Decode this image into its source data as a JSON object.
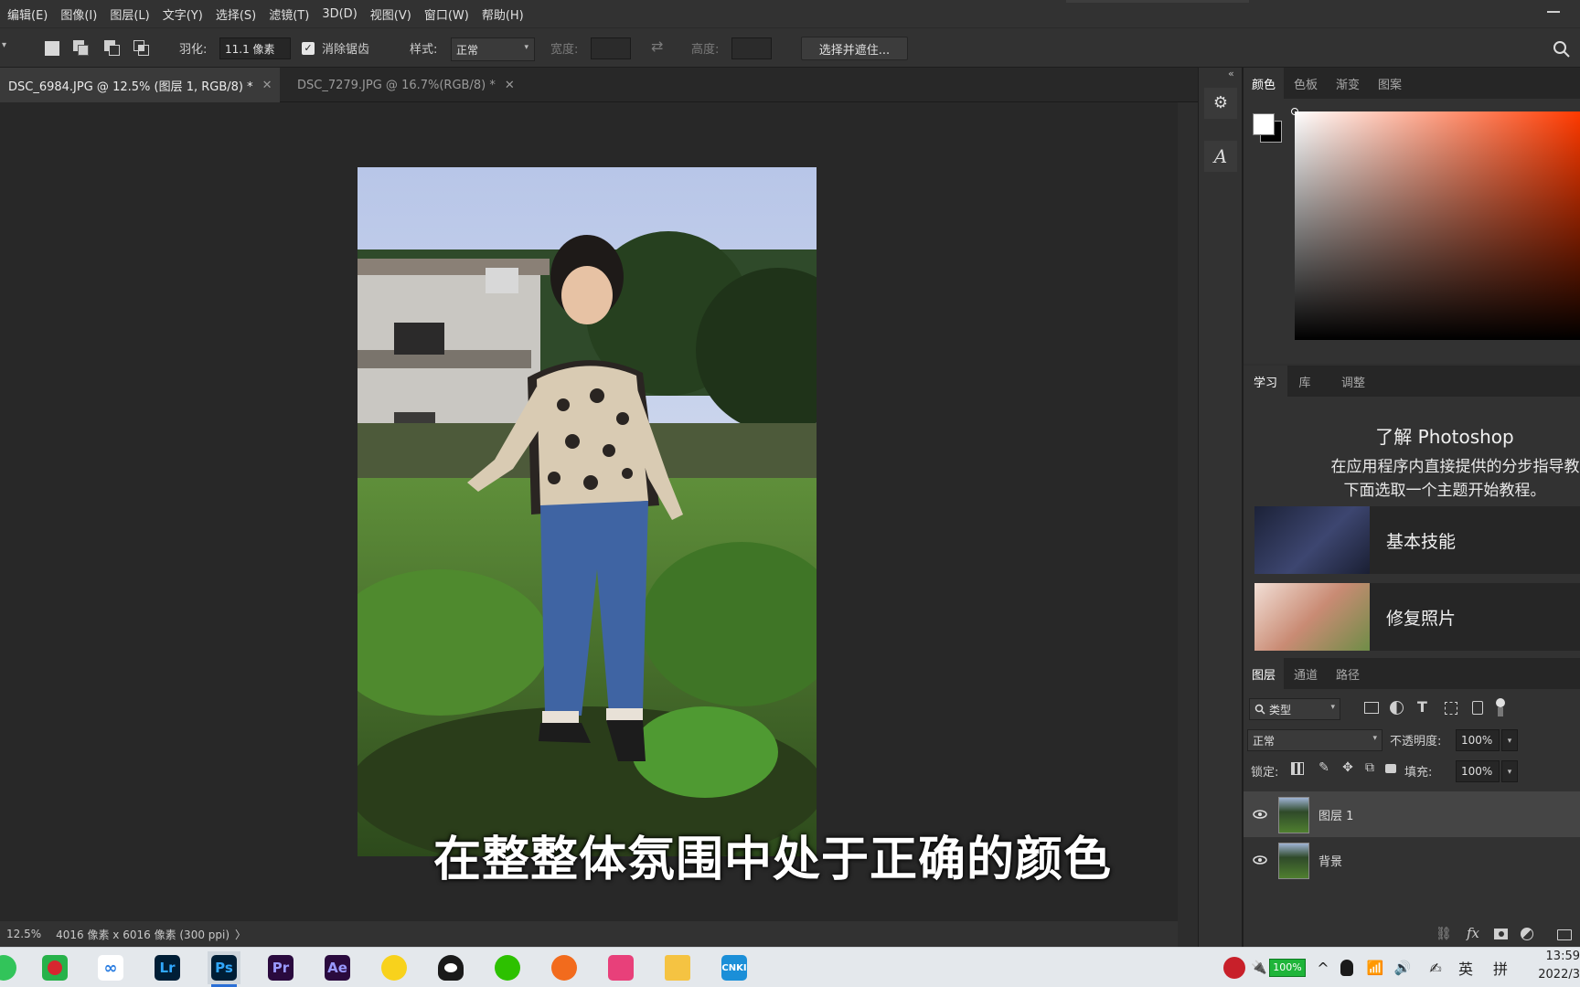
{
  "menu": {
    "items": [
      "编辑(E)",
      "图像(I)",
      "图层(L)",
      "文字(Y)",
      "选择(S)",
      "滤镜(T)",
      "3D(D)",
      "视图(V)",
      "窗口(W)",
      "帮助(H)"
    ]
  },
  "options": {
    "feather_label": "羽化:",
    "feather_value": "11.1 像素",
    "antialias_label": "消除锯齿",
    "antialias_checked": true,
    "style_label": "样式:",
    "style_value": "正常",
    "width_label": "宽度:",
    "height_label": "高度:",
    "select_mask_label": "选择并遮住..."
  },
  "tabs": [
    {
      "label": "DSC_6984.JPG @ 12.5% (图层 1, RGB/8) *",
      "active": true
    },
    {
      "label": "DSC_7279.JPG @ 16.7%(RGB/8) *",
      "active": false
    }
  ],
  "status": {
    "zoom": "12.5%",
    "doc_info": "4016 像素 x 6016 像素 (300 ppi)",
    "arrow": "〉"
  },
  "subtitle": "在整整体氛围中处于正确的颜色",
  "color_panel": {
    "tabs": [
      "颜色",
      "色板",
      "渐变",
      "图案"
    ]
  },
  "learn_panel": {
    "tabs": [
      "学习",
      "库",
      "调整"
    ],
    "title": "了解 Photoshop",
    "desc_line1": "在应用程序内直接提供的分步指导教程",
    "desc_line2": "下面选取一个主题开始教程。",
    "topics": [
      "基本技能",
      "修复照片"
    ]
  },
  "layers_panel": {
    "tabs": [
      "图层",
      "通道",
      "路径"
    ],
    "filter_label": "类型",
    "blend_mode": "正常",
    "opacity_label": "不透明度:",
    "opacity_value": "100%",
    "lock_label": "锁定:",
    "fill_label": "填充:",
    "fill_value": "100%",
    "layers": [
      {
        "name": "图层 1",
        "visible": true,
        "selected": true
      },
      {
        "name": "背景",
        "visible": true,
        "selected": false
      }
    ],
    "bottom_icons": [
      "link-icon",
      "fx-icon",
      "mask-icon",
      "adjustment-icon",
      "folder-icon"
    ]
  },
  "taskbar": {
    "apps": [
      "Lr",
      "Ps",
      "Pr",
      "Ae"
    ],
    "battery": "100%",
    "ime_lang": "英",
    "ime_mode": "拼",
    "time": "13:59",
    "date": "2022/3"
  },
  "colors": {
    "accent_fg": "#ffffff",
    "accent_bg": "#000000",
    "ps_blue": "#31a8ff",
    "pr_purple": "#9999ff",
    "ae_purple": "#9999ff",
    "lr_blue": "#31a8ff"
  }
}
